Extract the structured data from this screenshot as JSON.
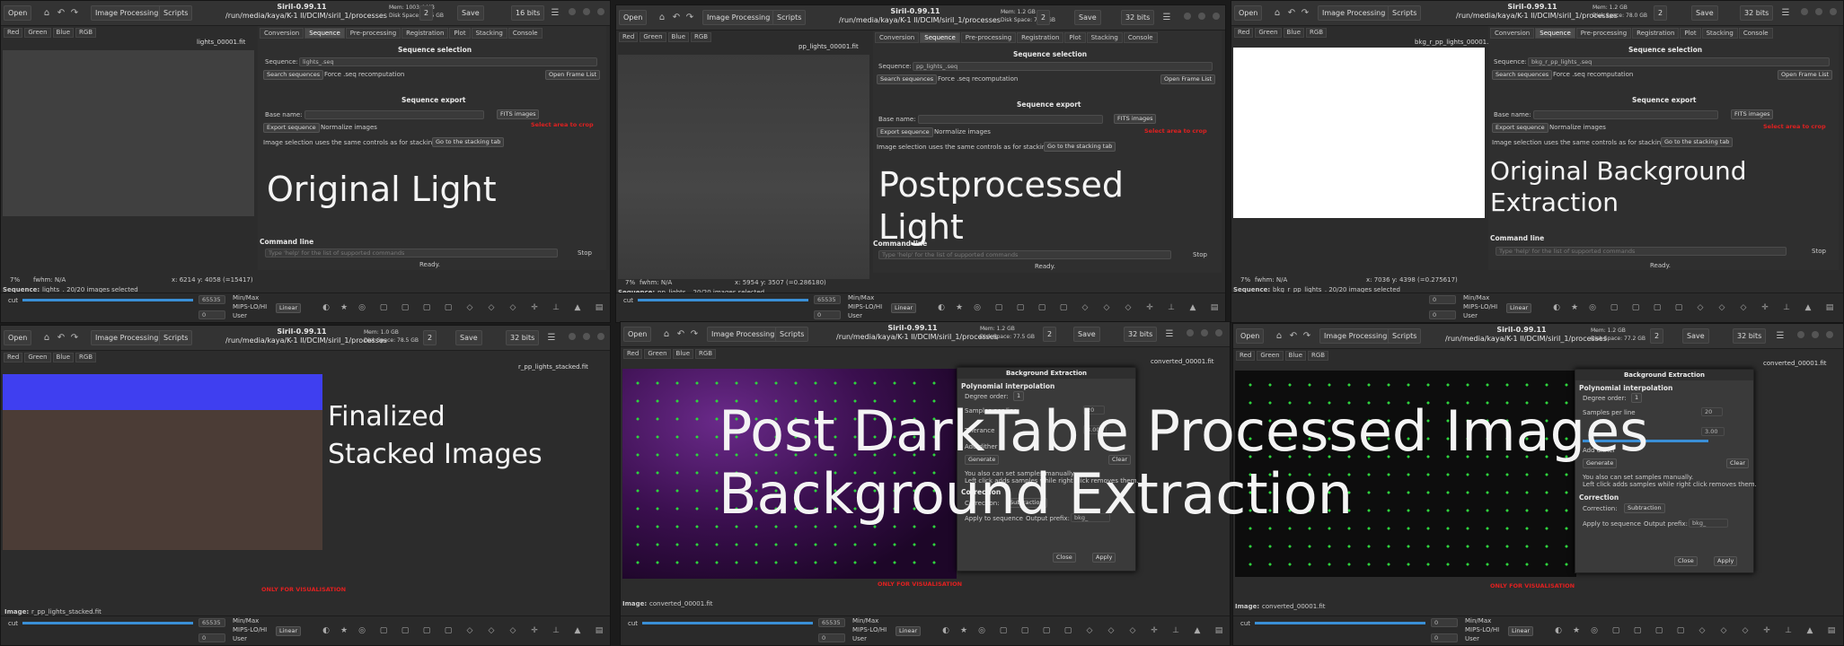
{
  "app": {
    "title": "Siril-0.99.11",
    "open": "Open",
    "image_processing": "Image Processing",
    "scripts": "Scripts",
    "save": "Save",
    "channels": [
      "Red",
      "Green",
      "Blue",
      "RGB"
    ]
  },
  "tabs": [
    "Conversion",
    "Sequence",
    "Pre-processing",
    "Registration",
    "Plot",
    "Stacking",
    "Console"
  ],
  "seq": {
    "selection": "Sequence selection",
    "sequence_label": "Sequence:",
    "search": "Search sequences",
    "force": "Force .seq recomputation",
    "open_list": "Open Frame List",
    "export": "Sequence export",
    "base": "Base name:",
    "fits": "FITS images",
    "export_btn": "Export sequence",
    "normalize": "Normalize images",
    "selnote": "Image selection uses the same controls as for stacking:",
    "goto": "Go to the stacking tab",
    "crop": "Select area to crop",
    "cmd": "Command line",
    "cmd_ph": "Type 'help' for the list of supported commands",
    "stop": "Stop",
    "ready": "Ready."
  },
  "bottom": {
    "cut": "cut",
    "val": "65535",
    "zero": "0",
    "minmax": "Min/Max",
    "mips": "MIPS-LO/HI",
    "user": "User",
    "linear": "Linear"
  },
  "only_vis": "ONLY FOR VISUALISATION",
  "panels": [
    {
      "path": "/run/media/kaya/K-1 II/DCIM/siril_1/processes",
      "mem": "Mem: 1003.4 MB",
      "disk": "Disk Space: 78.5 GB",
      "bits": "16 bits",
      "seq_num": "2",
      "file": "lights_00001.fit",
      "seq_name": "lights_.seq",
      "status_pct": "7%",
      "fwhm": "fwhm: N/A",
      "coords": "x: 6214  y: 4058 (=15417)",
      "footer_label": "Sequence:",
      "footer": "lights_. 20/20 images selected",
      "caption": "Original Light"
    },
    {
      "path": "/run/media/kaya/K-1 II/DCIM/siril_1/processes",
      "mem": "Mem: 1.2 GB",
      "disk": "Disk Space: 78.5 GB",
      "bits": "32 bits",
      "seq_num": "2",
      "file": "pp_lights_00001.fit",
      "seq_name": "pp_lights_.seq",
      "status_pct": "7%",
      "fwhm": "fwhm: N/A",
      "coords": "x: 5954  y: 3507 (=0.286180)",
      "footer_label": "Sequence:",
      "footer": "pp_lights_. 20/20 images selected",
      "caption_l1": "Postprocessed",
      "caption_l2": "Light"
    },
    {
      "path": "/run/media/kaya/K-1 II/DCIM/siril_1/processes",
      "mem": "Mem: 1.2 GB",
      "disk": "Disk Space: 78.0 GB",
      "bits": "32 bits",
      "seq_num": "2",
      "file": "bkg_r_pp_lights_00001.fit",
      "seq_name": "bkg_r_pp_lights_.seq",
      "status_pct": "7%",
      "fwhm": "fwhm: N/A",
      "coords": "x: 7036  y: 4398 (=0.275617)",
      "footer_label": "Sequence:",
      "footer": "bkg_r_pp_lights_. 20/20 images selected",
      "caption_l1": "Original Background",
      "caption_l2": "Extraction"
    },
    {
      "path": "/run/media/kaya/K-1 II/DCIM/siril_1/processes",
      "mem": "Mem: 1.0 GB",
      "disk": "Disk Space: 78.5 GB",
      "bits": "32 bits",
      "seq_num": "2",
      "file": "r_pp_lights_stacked.fit",
      "footer_label": "Image:",
      "footer": "r_pp_lights_stacked.fit",
      "caption_l1": "Finalized",
      "caption_l2": "Stacked Images"
    },
    {
      "path": "/run/media/kaya/K-1 II/DCIM/siril_1/processes",
      "mem": "Mem: 1.2 GB",
      "disk": "Disk Space: 77.5 GB",
      "bits": "32 bits",
      "seq_num": "2",
      "file": "converted_00001.fit",
      "footer_label": "Image:",
      "footer": "converted_00001.fit"
    },
    {
      "path": "/run/media/kaya/K-1 II/DCIM/siril_1/processes",
      "mem": "Mem: 1.2 GB",
      "disk": "Disk Space: 77.2 GB",
      "bits": "32 bits",
      "seq_num": "2",
      "file": "converted_00001.fit",
      "footer_label": "Image:",
      "footer": "converted_00001.fit"
    }
  ],
  "bkg": {
    "title": "Background Extraction",
    "poly": "Polynomial interpolation",
    "degree": "Degree order:",
    "degree_val": "1",
    "samples": "Samples per line",
    "samples_val": "20",
    "tolerance": "Tolerance",
    "tol_val": "3.00",
    "dither": "Add dither",
    "generate": "Generate",
    "clear": "Clear",
    "manual": "You also can set samples manually.",
    "manual2": "Left click adds samples while right click removes them.",
    "correction_h": "Correction",
    "correction": "Correction:",
    "corr_val": "Subtraction",
    "apply_seq": "Apply to sequence",
    "prefix": "Output prefix:",
    "prefix_val": "bkg_",
    "close": "Close",
    "apply": "Apply"
  },
  "overlay_l1": "Post DarkTable Processed Images",
  "overlay_l2": "Background Extraction"
}
